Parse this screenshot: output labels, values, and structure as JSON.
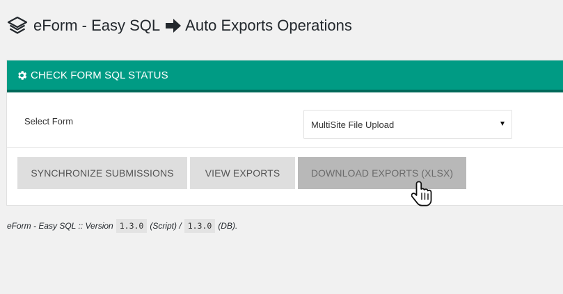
{
  "header": {
    "icon": "layers-icon",
    "title_left": "eForm - Easy SQL",
    "arrow_icon": "arrow-right-icon",
    "title_right": "Auto Exports Operations"
  },
  "panel": {
    "heading": "CHECK FORM SQL STATUS",
    "heading_icon": "gear-icon",
    "heading_color": "#009b84",
    "form_row": {
      "label": "Select Form",
      "selected_value": "MultiSite File Upload"
    },
    "buttons": {
      "synchronize": "SYNCHRONIZE SUBMISSIONS",
      "view": "VIEW EXPORTS",
      "download": "DOWNLOAD EXPORTS (XLSX)"
    }
  },
  "footer": {
    "prefix": "eForm - Easy SQL :: Version",
    "script_version": "1.3.0",
    "script_label": "(Script) /",
    "db_version": "1.3.0",
    "db_label": "(DB)."
  },
  "cursor": "hand-pointer-icon"
}
